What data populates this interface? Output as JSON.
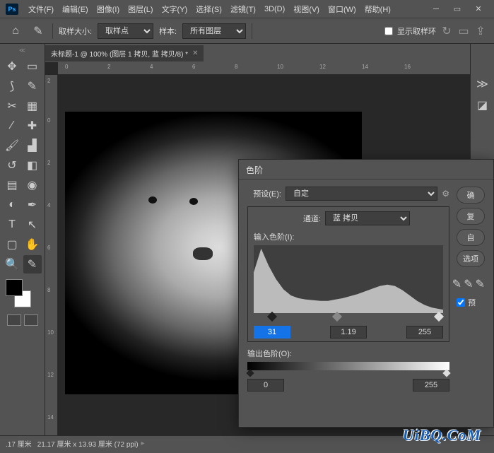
{
  "app": {
    "logo": "Ps"
  },
  "menu": [
    "文件(F)",
    "编辑(E)",
    "图像(I)",
    "图层(L)",
    "文字(Y)",
    "选择(S)",
    "滤镜(T)",
    "3D(D)",
    "视图(V)",
    "窗口(W)",
    "帮助(H)"
  ],
  "options": {
    "sample_size_label": "取样大小:",
    "sample_size_value": "取样点",
    "sample_label": "样本:",
    "sample_value": "所有图层",
    "show_ring": "显示取样环"
  },
  "tab": {
    "title": "未标题-1 @ 100% (图层 1 拷贝, 蓝 拷贝/8) *"
  },
  "ruler_h": [
    "0",
    "2",
    "4",
    "6",
    "8",
    "10",
    "12",
    "14",
    "16"
  ],
  "ruler_v": [
    "2",
    "0",
    "2",
    "4",
    "6",
    "8",
    "10",
    "12",
    "14"
  ],
  "status": {
    "zoom": ".17 厘米",
    "dims": "21.17 厘米 x 13.93 厘米 (72 ppi)"
  },
  "levels": {
    "title": "色阶",
    "preset_label": "预设(E):",
    "preset_value": "自定",
    "channel_label": "通道:",
    "channel_value": "蓝 拷贝",
    "input_label": "输入色阶(I):",
    "in_black": "31",
    "in_mid": "1.19",
    "in_white": "255",
    "output_label": "输出色阶(O):",
    "out_black": "0",
    "out_white": "255",
    "btn_ok": "确",
    "btn_cancel": "复",
    "btn_auto": "自",
    "btn_options": "选项",
    "preview": "预"
  },
  "watermark": "UiBQ.CoM",
  "chart_data": {
    "type": "area",
    "title": "输入色阶(I):",
    "xlabel": "",
    "ylabel": "",
    "xlim": [
      0,
      255
    ],
    "ylim": [
      0,
      100
    ],
    "x": [
      0,
      10,
      20,
      30,
      40,
      50,
      60,
      70,
      80,
      90,
      100,
      110,
      120,
      130,
      140,
      150,
      160,
      170,
      180,
      190,
      200,
      210,
      220,
      230,
      240,
      255
    ],
    "values": [
      60,
      95,
      70,
      50,
      35,
      26,
      22,
      20,
      19,
      18,
      18,
      20,
      22,
      25,
      28,
      32,
      36,
      40,
      42,
      40,
      34,
      26,
      18,
      12,
      8,
      5
    ]
  }
}
